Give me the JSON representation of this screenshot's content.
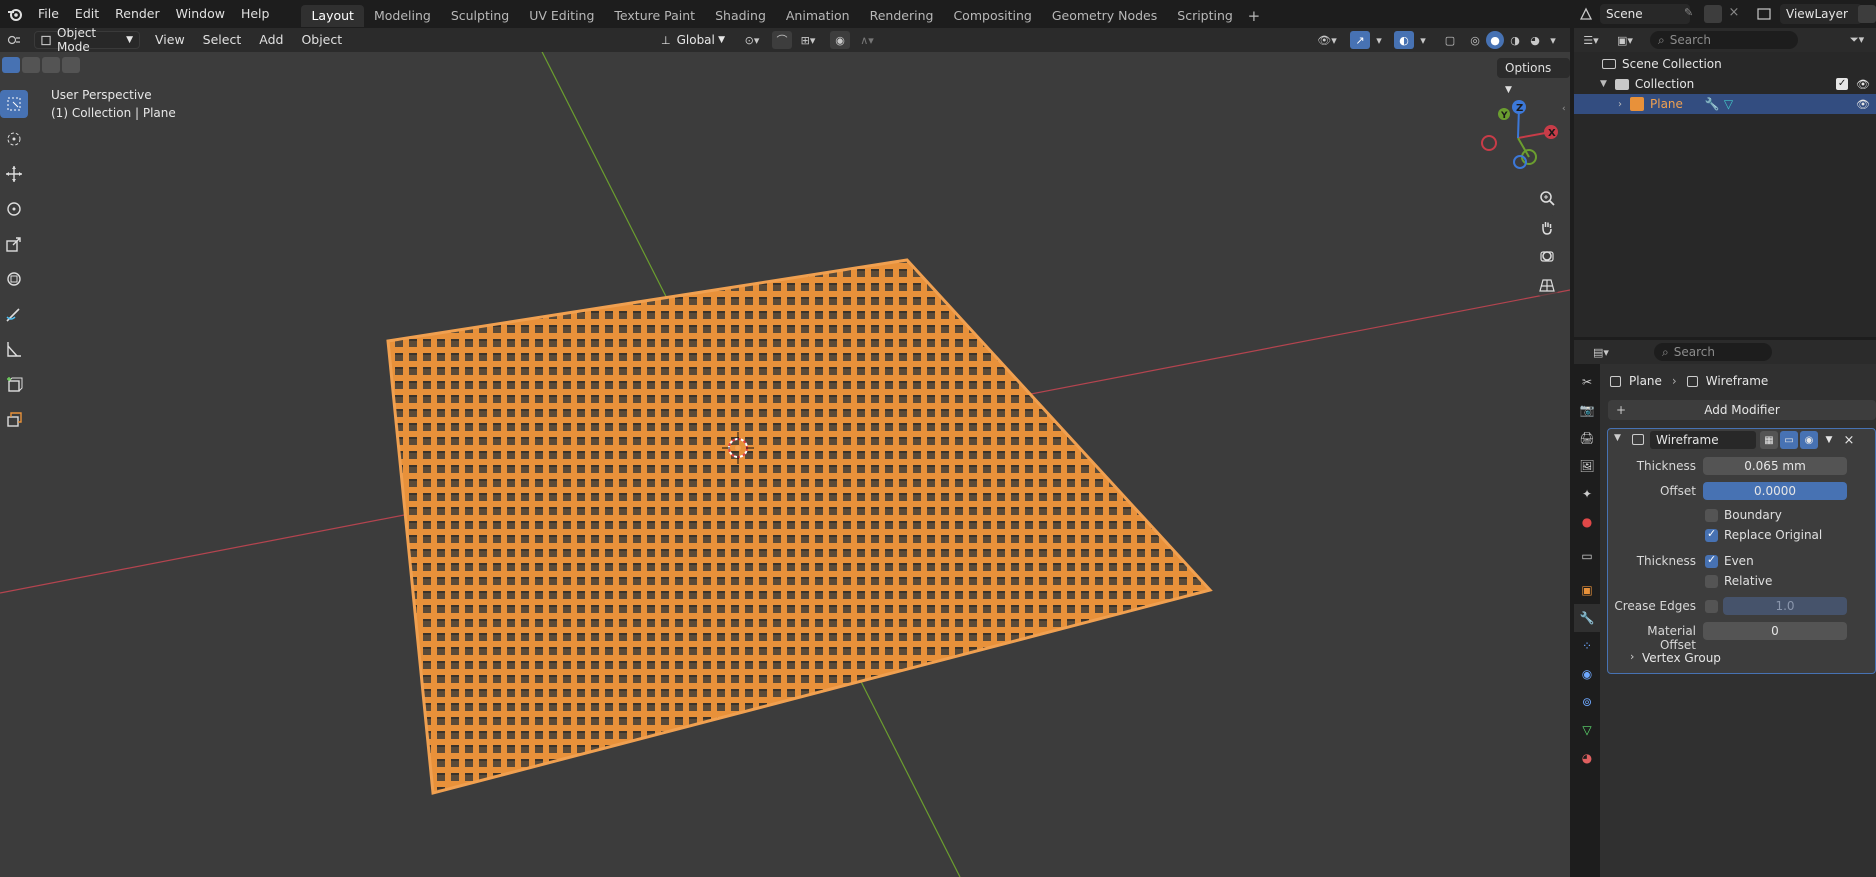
{
  "menu": [
    "File",
    "Edit",
    "Render",
    "Window",
    "Help"
  ],
  "workspaces": [
    "Layout",
    "Modeling",
    "Sculpting",
    "UV Editing",
    "Texture Paint",
    "Shading",
    "Animation",
    "Rendering",
    "Compositing",
    "Geometry Nodes",
    "Scripting"
  ],
  "active_workspace": "Layout",
  "scene_name": "Scene",
  "view_layer": "ViewLayer",
  "viewport": {
    "mode": "Object Mode",
    "menus": [
      "View",
      "Select",
      "Add",
      "Object"
    ],
    "transform_orientation": "Global",
    "options_label": "Options",
    "perspective_label": "User Perspective",
    "collection_label": "(1) Collection | Plane",
    "gizmo_axes": {
      "x": "X",
      "y": "Y",
      "z": "Z"
    }
  },
  "outliner": {
    "search_placeholder": "Search",
    "scene_collection": "Scene Collection",
    "collection": "Collection",
    "object": "Plane"
  },
  "properties": {
    "search_placeholder": "Search",
    "breadcrumb_object": "Plane",
    "breadcrumb_modifier": "Wireframe",
    "add_modifier_label": "Add Modifier",
    "modifier": {
      "name": "Wireframe",
      "thickness_label": "Thickness",
      "thickness_value": "0.065 mm",
      "offset_label": "Offset",
      "offset_value": "0.0000",
      "boundary_label": "Boundary",
      "boundary_checked": false,
      "replace_original_label": "Replace Original",
      "replace_original_checked": true,
      "thickness2_label": "Thickness",
      "even_label": "Even",
      "even_checked": true,
      "relative_label": "Relative",
      "relative_checked": false,
      "crease_edges_label": "Crease Edges",
      "crease_value": "1.0",
      "material_offset_label": "Material Offset",
      "material_offset_value": "0",
      "vertex_group_label": "Vertex Group"
    }
  },
  "colors": {
    "accent": "#4772b3",
    "selection_orange": "#f0a050",
    "x_axis": "#c83c48",
    "y_axis": "#6b9e2f",
    "z_axis": "#3c78d8"
  }
}
